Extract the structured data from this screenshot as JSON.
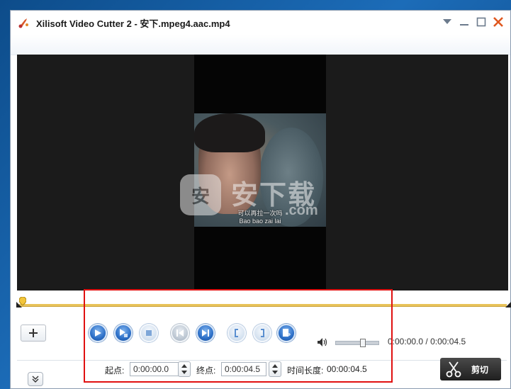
{
  "window": {
    "title": "Xilisoft Video Cutter 2 - 安下.mpeg4.aac.mp4",
    "icon": "scissors-app-icon"
  },
  "video": {
    "subtitle": "可以再拉一次吗",
    "subtitle2": "Bao bao zai lai",
    "watermark_text": "安下载",
    "watermark_domain": ".com",
    "watermark_badge": "安"
  },
  "timeline": {
    "position": 0.0,
    "accent": "#e8c35a"
  },
  "controls": {
    "buttons": [
      "play",
      "play-selection",
      "stop",
      "previous-frame",
      "next-frame",
      "set-start",
      "set-end",
      "add-segment"
    ],
    "volume_level": 0.62,
    "current_time": "0:00:00.0",
    "total_time": "0:00:04.5",
    "time_separator": "/"
  },
  "bottom": {
    "start_label": "起点:",
    "start_value": "0:00:00.0",
    "end_label": "终点:",
    "end_value": "0:00:04.5",
    "duration_label": "时间长度:",
    "duration_value": "00:00:04.5",
    "cut_label": "剪切"
  },
  "colors": {
    "highlight": "#e01010",
    "button_blue": "#2c6fc7"
  }
}
